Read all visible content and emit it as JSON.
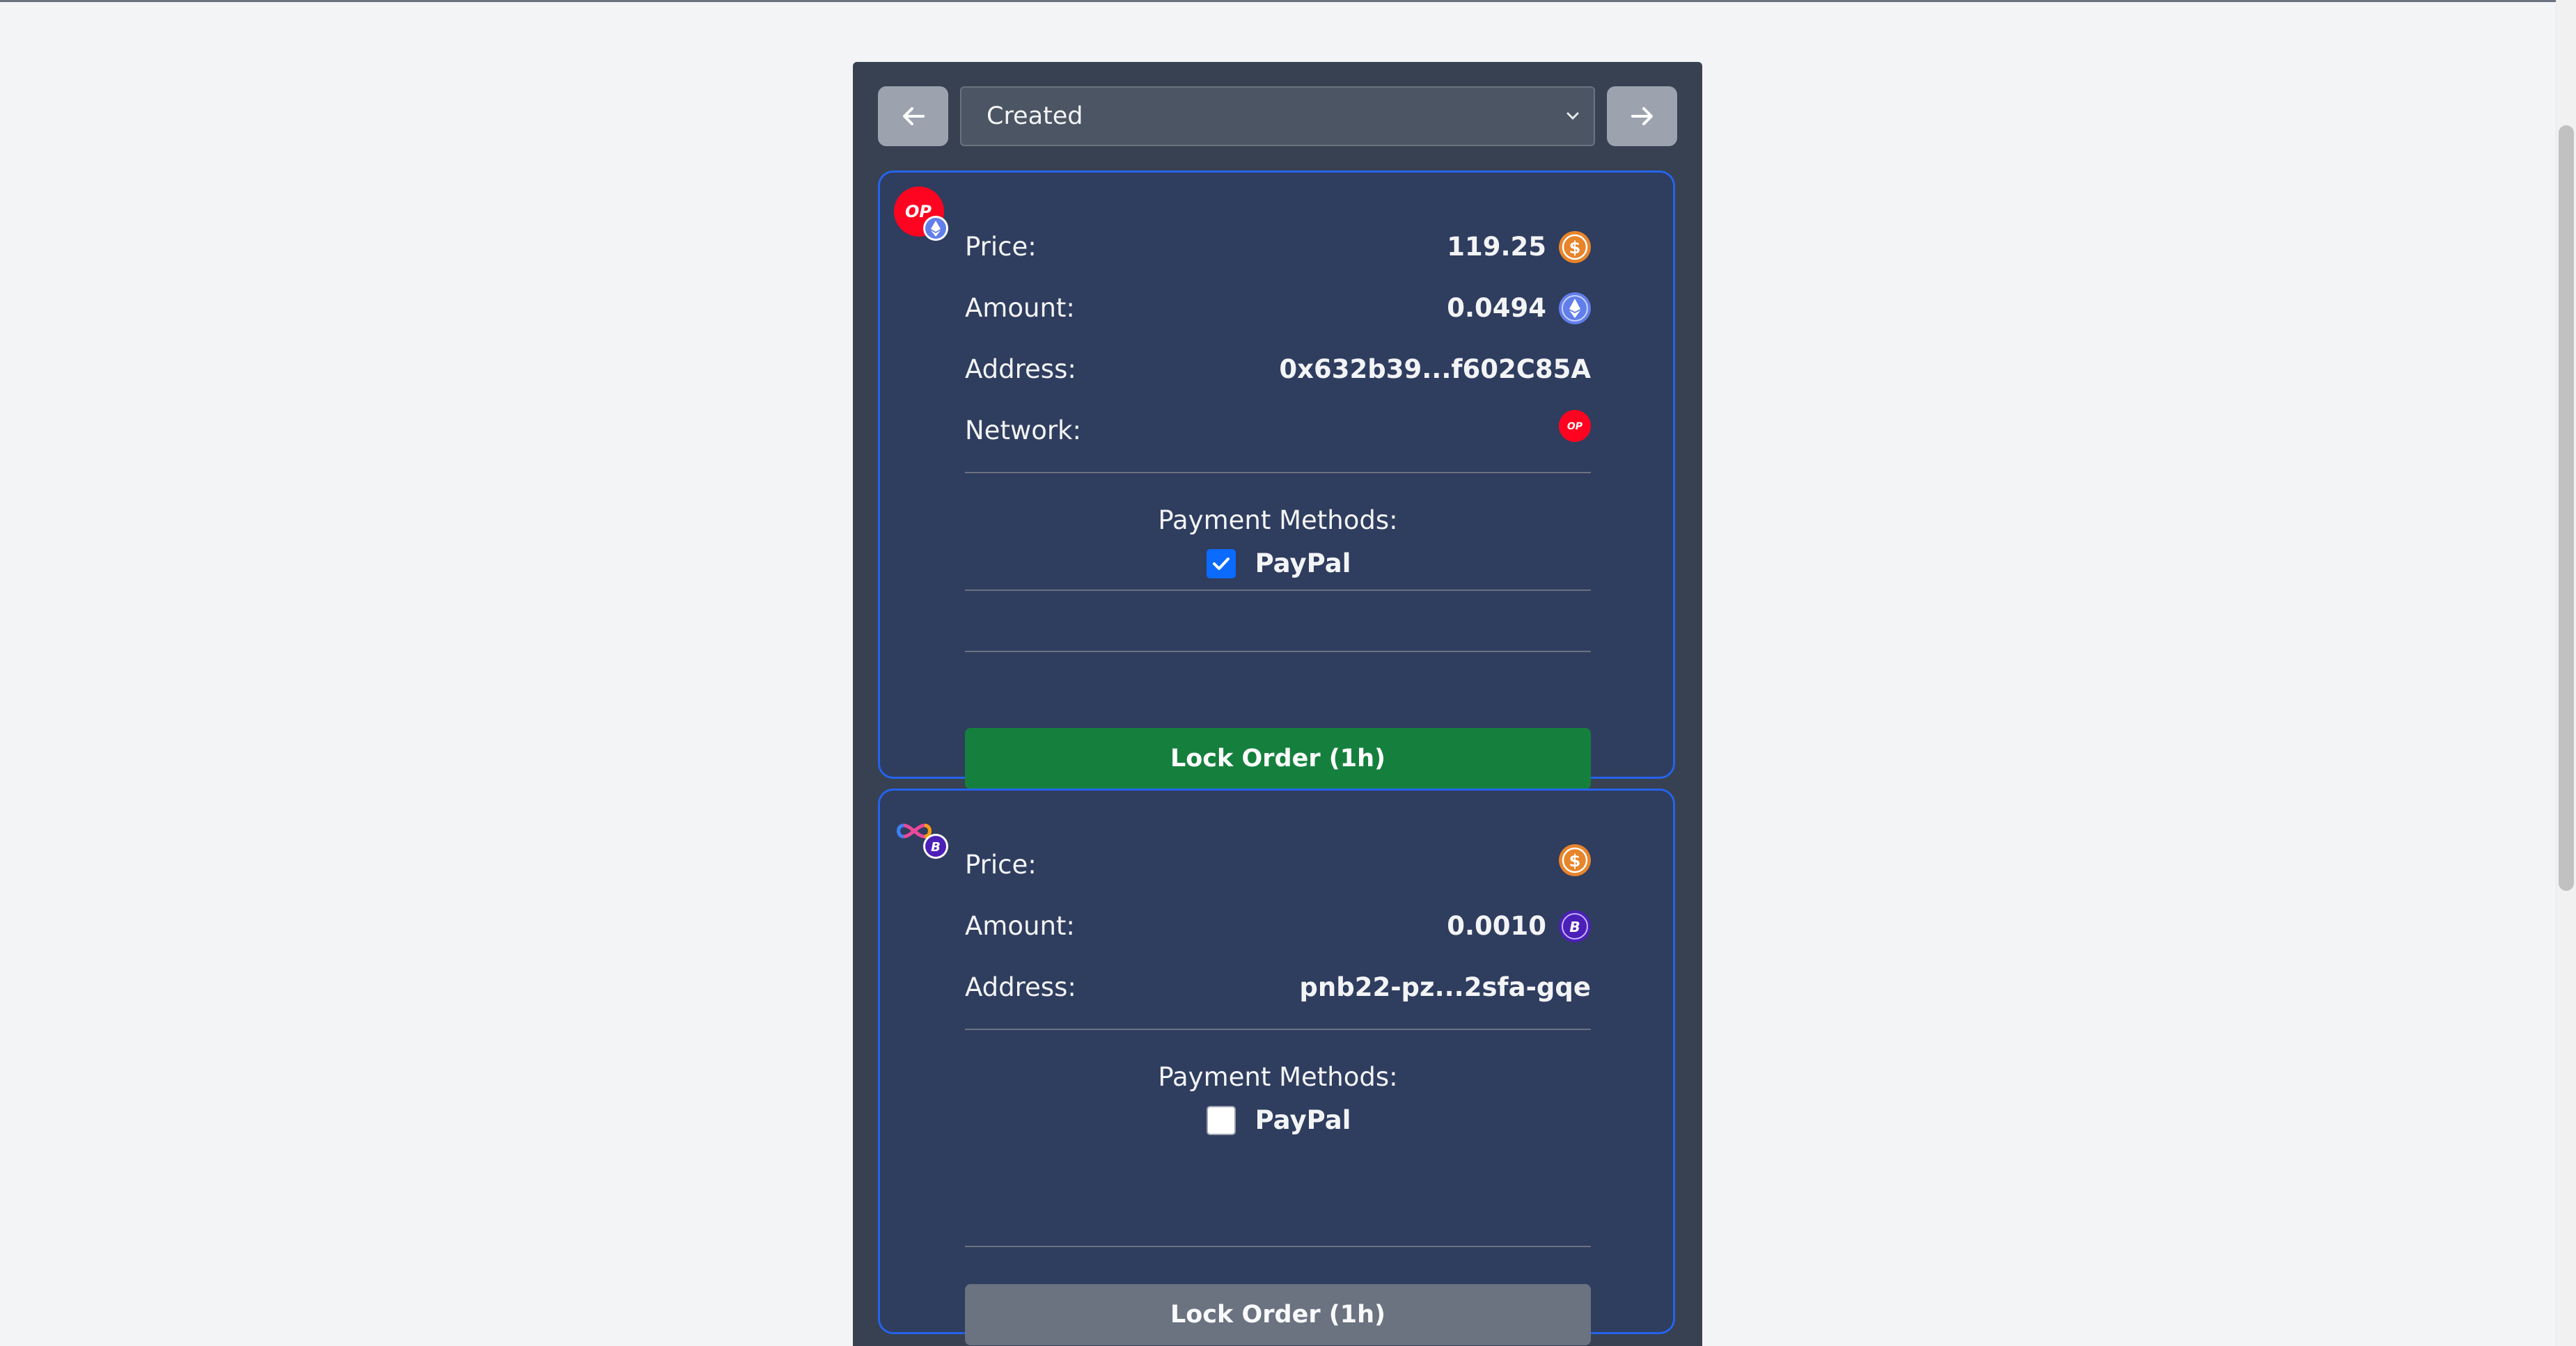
{
  "filter": {
    "prev_icon": "arrow-left-icon",
    "next_icon": "arrow-right-icon",
    "selected_status": "Created",
    "chevron_icon": "chevron-down-icon"
  },
  "orders": [
    {
      "token_icon": "optimism-ethereum-token-icon",
      "price_label": "Price:",
      "price_value": "119.25",
      "price_currency_icon": "usd-coin-icon",
      "amount_label": "Amount:",
      "amount_value": "0.0494",
      "amount_currency_icon": "ethereum-icon",
      "address_label": "Address:",
      "address_value": "0x632b39...f602C85A",
      "network_label": "Network:",
      "network_icon": "optimism-icon",
      "payment_methods_title": "Payment Methods:",
      "payment_method": "PayPal",
      "payment_method_checked": true,
      "lock_button": "Lock Order (1h)",
      "lock_enabled": true
    },
    {
      "token_icon": "icp-bitcoin-token-icon",
      "price_label": "Price:",
      "price_value": "",
      "price_currency_icon": "usd-coin-icon",
      "amount_label": "Amount:",
      "amount_value": "0.0010",
      "amount_currency_icon": "bitcoin-icon",
      "address_label": "Address:",
      "address_value": "pnb22-pz...2sfa-gqe",
      "payment_methods_title": "Payment Methods:",
      "payment_method": "PayPal",
      "payment_method_checked": false,
      "lock_button": "Lock Order (1h)",
      "lock_enabled": false
    }
  ],
  "colors": {
    "page_bg": "#f3f4f6",
    "panel_bg": "#374151",
    "card_bg": "#2f3d5f",
    "card_border": "#2563eb",
    "lock_active": "#15803d",
    "lock_disabled": "#6b7280",
    "optimism_red": "#ff0420",
    "usd_orange": "#e8842a",
    "eth_blue": "#627eea",
    "btc_purple": "#4b1fb8"
  }
}
